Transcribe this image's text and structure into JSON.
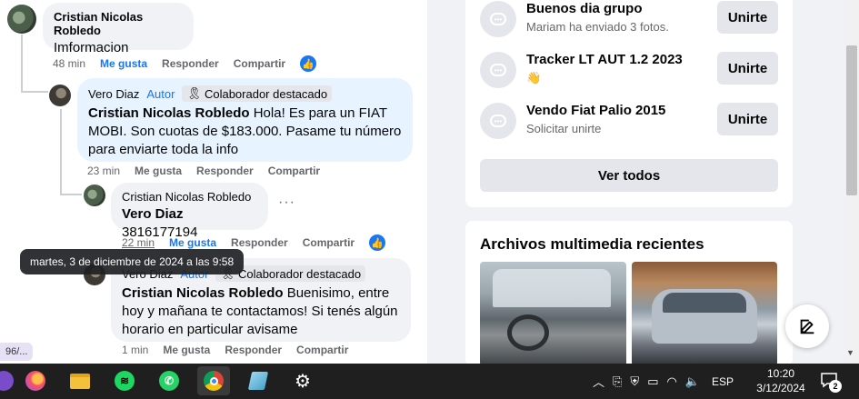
{
  "comments": [
    {
      "author": "Cristian Nicolas Robledo",
      "text": "Imformacion",
      "time": "48 min",
      "like": "Me gusta",
      "reply": "Responder",
      "share": "Compartir"
    },
    {
      "author": "Vero Diaz",
      "autor_badge": "Autor",
      "colab_badge": "Colaborador destacado",
      "mention": "Cristian Nicolas Robledo",
      "text": " Hola! Es para un FIAT MOBI. Son cuotas de $183.000. Pasame tu número para enviarte toda la info",
      "time": "23 min",
      "like": "Me gusta",
      "reply": "Responder",
      "share": "Compartir"
    },
    {
      "author": "Cristian Nicolas Robledo",
      "mention": "Vero Diaz",
      "text": " 3816177194",
      "time": "22 min",
      "like": "Me gusta",
      "reply": "Responder",
      "share": "Compartir",
      "more": "···"
    },
    {
      "author": "Vero Diaz",
      "autor_badge": "Autor",
      "colab_badge": "Colaborador destacado",
      "mention": "Cristian Nicolas Robledo",
      "text": " Buenisimo, entre hoy y mañana te contactamos! Si tenés algún horario en particular avisame",
      "time": "1 min",
      "like": "Me gusta",
      "reply": "Responder",
      "share": "Compartir"
    }
  ],
  "tooltip": "martes, 3 de diciembre de 2024 a las 9:58",
  "edge_chip": "96/...",
  "groups": [
    {
      "name": "Buenos dia grupo",
      "sub": "Mariam ha enviado 3 fotos.",
      "button": "Unirte"
    },
    {
      "name": "Tracker LT AUT 1.2 2023",
      "sub": "👋",
      "button": "Unirte"
    },
    {
      "name": "Vendo Fiat Palio 2015",
      "sub": "Solicitar unirte",
      "button": "Unirte"
    }
  ],
  "see_all": "Ver todos",
  "media_title": "Archivos multimedia recientes",
  "taskbar": {
    "lang": "ESP",
    "time": "10:20",
    "date": "3/12/2024",
    "notif_count": "2"
  },
  "colors": {
    "facebook_blue": "#1877f2",
    "bubble_gray": "#f0f2f5",
    "bubble_blue": "#e7f3ff"
  }
}
